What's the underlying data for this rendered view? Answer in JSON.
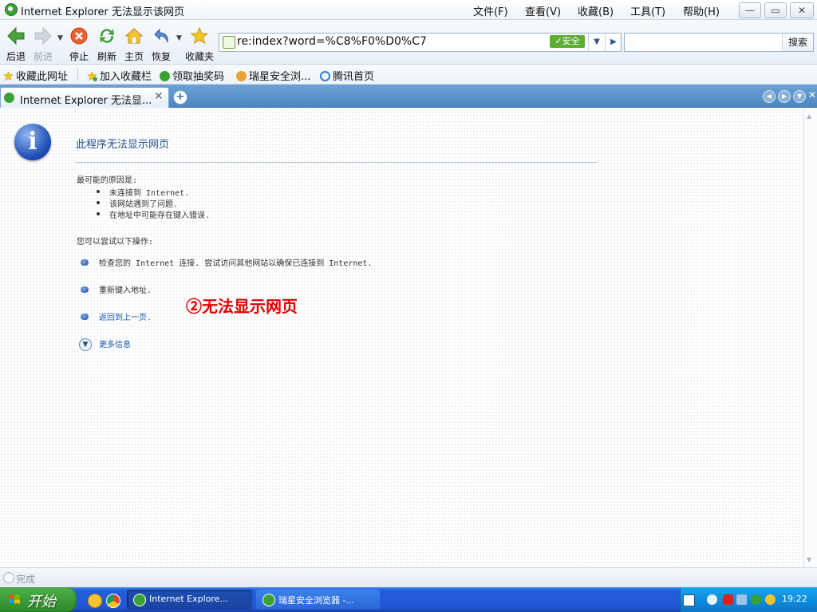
{
  "window": {
    "title": "Internet Explorer 无法显示该网页",
    "controls": {
      "minimize": "—",
      "restore": "▭",
      "close": "✕"
    }
  },
  "menu": [
    "文件(F)",
    "查看(V)",
    "收藏(B)",
    "工具(T)",
    "帮助(H)"
  ],
  "toolbar": {
    "back": "后退",
    "forward": "前进",
    "stop": "停止",
    "refresh": "刷新",
    "home": "主页",
    "restore": "恢复",
    "favorites": "收藏夹"
  },
  "address": {
    "url": "re:index?word=%C8%F0%D0%C7",
    "badge": "✓安全",
    "go_icon": "arrow-right-icon"
  },
  "search": {
    "button": "搜索",
    "value": ""
  },
  "favbar": [
    "收藏此网址",
    "加入收藏栏",
    "领取抽奖码",
    "瑞星安全浏...",
    "腾讯首页"
  ],
  "tab": {
    "label": "Internet Explorer 无法显...",
    "close": "✕",
    "new": "+"
  },
  "page": {
    "heading": "此程序无法显示网页",
    "reasons_title": "最可能的原因是:",
    "reasons": [
      "未连接到 Internet.",
      "该网站遇到了问题.",
      "在地址中可能存在键入错误."
    ],
    "actions_title": "您可以尝试以下操作:",
    "actions": [
      "检查您的 Internet 连接. 尝试访问其他网站以确保已连接到 Internet.",
      "重新键入地址.",
      "返回到上一页."
    ],
    "more_info": "更多信息",
    "annotation": "②无法显示网页"
  },
  "status": {
    "text": "完成"
  },
  "taskbar": {
    "start": "开始",
    "tasks": [
      "Internet Explore...",
      "瑞星安全浏览器 -..."
    ],
    "clock": "19:22"
  },
  "colors": {
    "accent": "#1f4d8a",
    "annotation": "#e00000",
    "taskbar": "#245edb",
    "start": "#3a9a36"
  }
}
